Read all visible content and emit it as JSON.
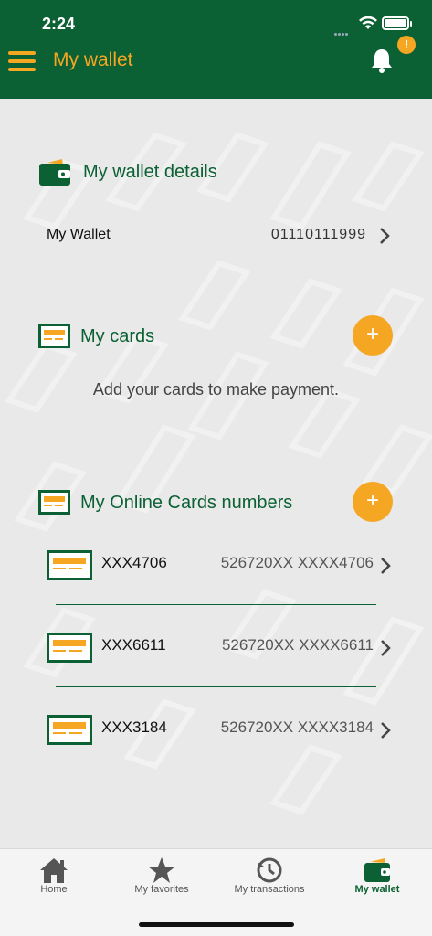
{
  "status_bar": {
    "time": "2:24"
  },
  "header": {
    "title": "My wallet",
    "notification_badge": "!"
  },
  "wallet_details": {
    "title": "My wallet details",
    "label": "My Wallet",
    "number": "01110111999"
  },
  "my_cards": {
    "title": "My cards",
    "add_label": "+",
    "empty_message": "Add your cards to make payment."
  },
  "online_cards": {
    "title": "My Online Cards numbers",
    "add_label": "+",
    "items": [
      {
        "name": "XXX4706",
        "number": "526720XX XXXX4706"
      },
      {
        "name": "XXX6611",
        "number": "526720XX XXXX6611"
      },
      {
        "name": "XXX3184",
        "number": "526720XX XXXX3184"
      }
    ]
  },
  "bottom_nav": {
    "items": [
      {
        "label": "Home",
        "icon": "home-icon"
      },
      {
        "label": "My favorites",
        "icon": "star-icon"
      },
      {
        "label": "My transactions",
        "icon": "history-icon"
      },
      {
        "label": "My wallet",
        "icon": "wallet-icon"
      }
    ],
    "active": "My wallet"
  },
  "colors": {
    "primary": "#0b6133",
    "accent": "#f5a623",
    "background": "#e9e9e9"
  }
}
